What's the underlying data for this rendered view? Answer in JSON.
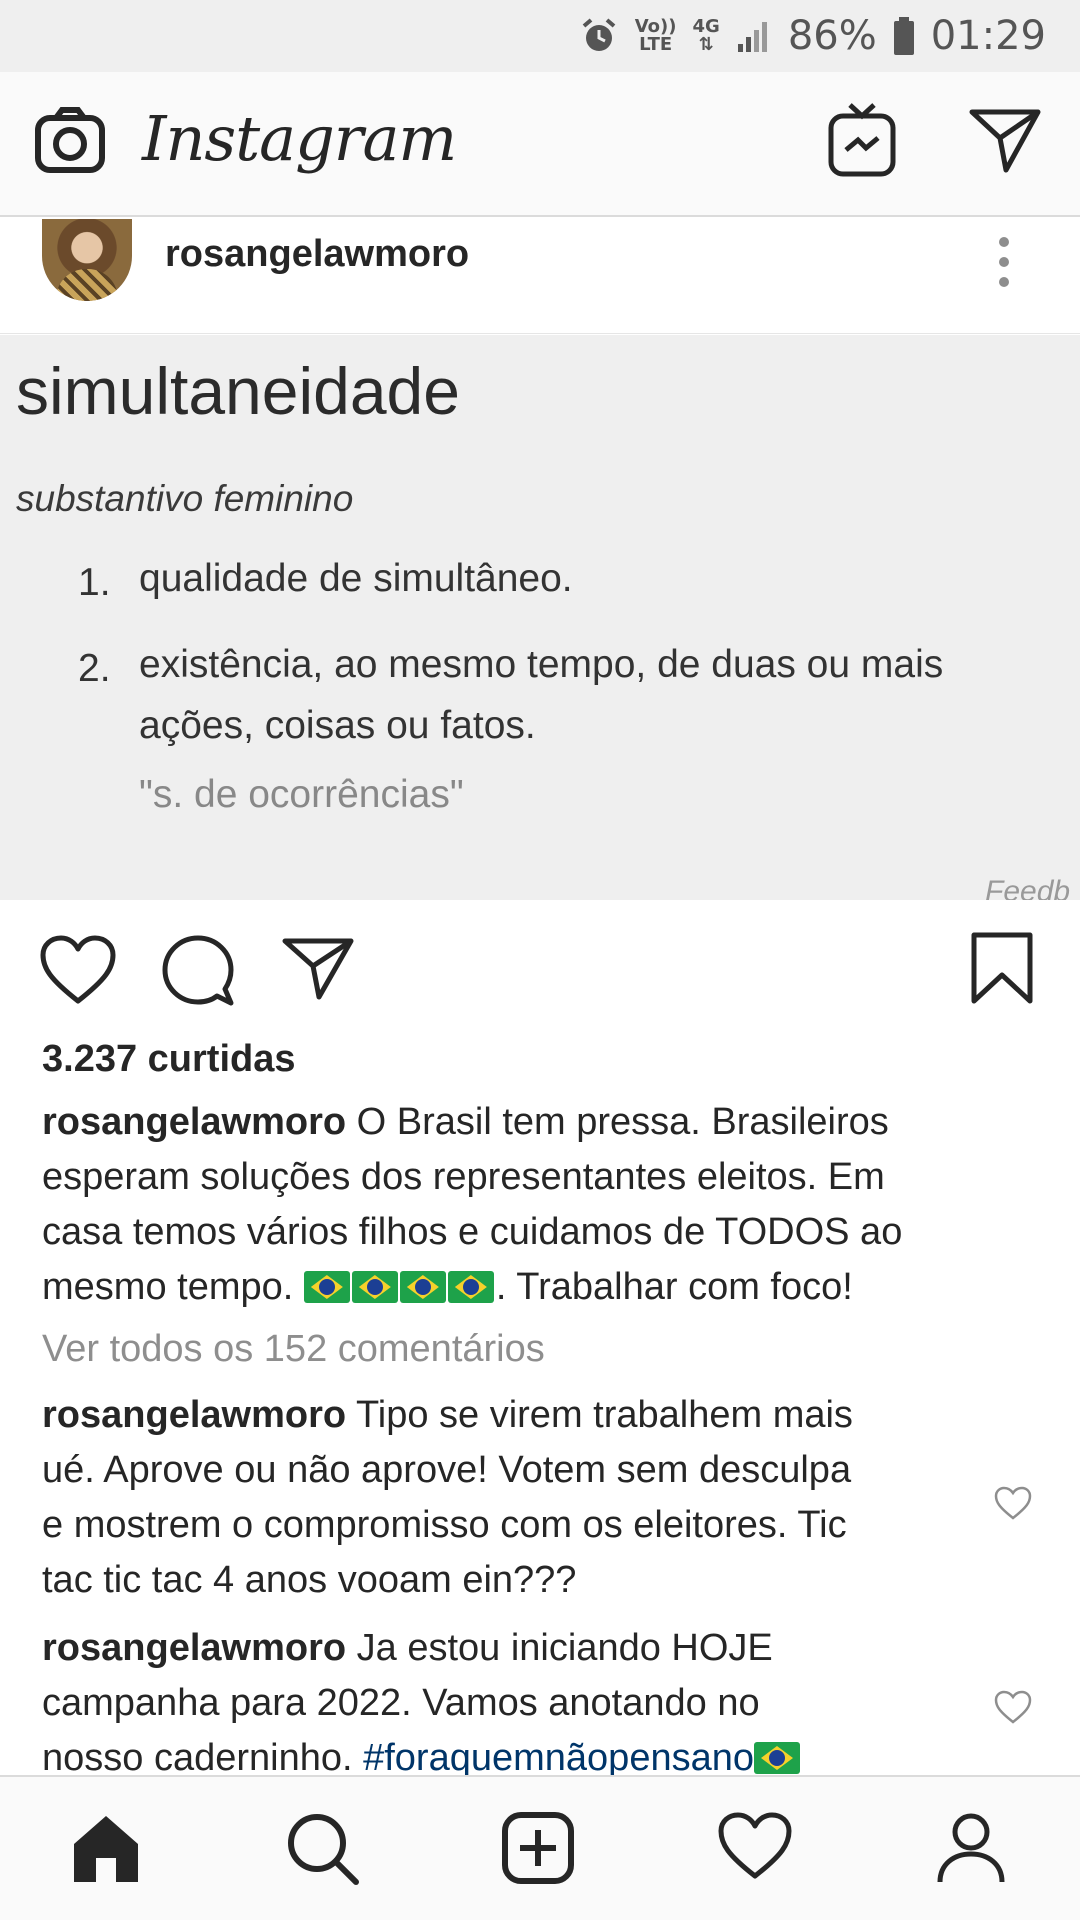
{
  "status_bar": {
    "volte_top": "Vo))",
    "volte_bottom": "LTE",
    "network": "4G",
    "battery": "86%",
    "time": "01:29",
    "icons": [
      "alarm-icon",
      "volte-icon",
      "network-4g-icon",
      "signal-icon",
      "battery-icon"
    ]
  },
  "app_bar": {
    "title": "Instagram",
    "icons": [
      "camera-icon",
      "igtv-icon",
      "direct-message-icon"
    ]
  },
  "post": {
    "username": "rosangelawmoro",
    "image": {
      "term": "simultaneidade",
      "part_of_speech": "substantivo feminino",
      "definitions": [
        {
          "num": "1.",
          "text": "qualidade de simultâneo."
        },
        {
          "num": "2.",
          "line1": "existência, ao mesmo tempo, de duas ou mais",
          "line2": "ações, coisas ou fatos."
        }
      ],
      "example": "\"s. de ocorrências\"",
      "feedback": "Feedb"
    },
    "likes": "3.237 curtidas",
    "caption": {
      "username": "rosangelawmoro",
      "line1": "O Brasil tem pressa. Brasileiros",
      "line2": "esperam soluções dos representantes eleitos. Em",
      "line3": "casa temos vários filhos e cuidamos de TODOS ao",
      "line4_prefix": "mesmo tempo. ",
      "line4_suffix": ". Trabalhar com foco!"
    },
    "view_all_comments": "Ver todos os 152 comentários",
    "comments": [
      {
        "username": "rosangelawmoro",
        "line1": "Tipo se virem trabalhem mais",
        "line2": "ué. Aprove ou não aprove! Votem sem desculpa",
        "line3": "e mostrem o compromisso com os eleitores. Tic",
        "line4": "tac tic tac 4 anos vooam ein???"
      },
      {
        "username": "rosangelawmoro",
        "line1": "Ja estou iniciando HOJE",
        "line2": "campanha para 2022. Vamos anotando no",
        "line3_prefix": "nosso caderninho. ",
        "hashtag": "#foraquemnãopensano"
      }
    ]
  },
  "bottom_nav": [
    "home-icon",
    "search-icon",
    "new-post-icon",
    "activity-heart-icon",
    "profile-icon"
  ],
  "colors": {
    "hashtag": "#003569",
    "muted": "#8e8e8e",
    "text": "#262626",
    "image_bg": "#efefef"
  }
}
